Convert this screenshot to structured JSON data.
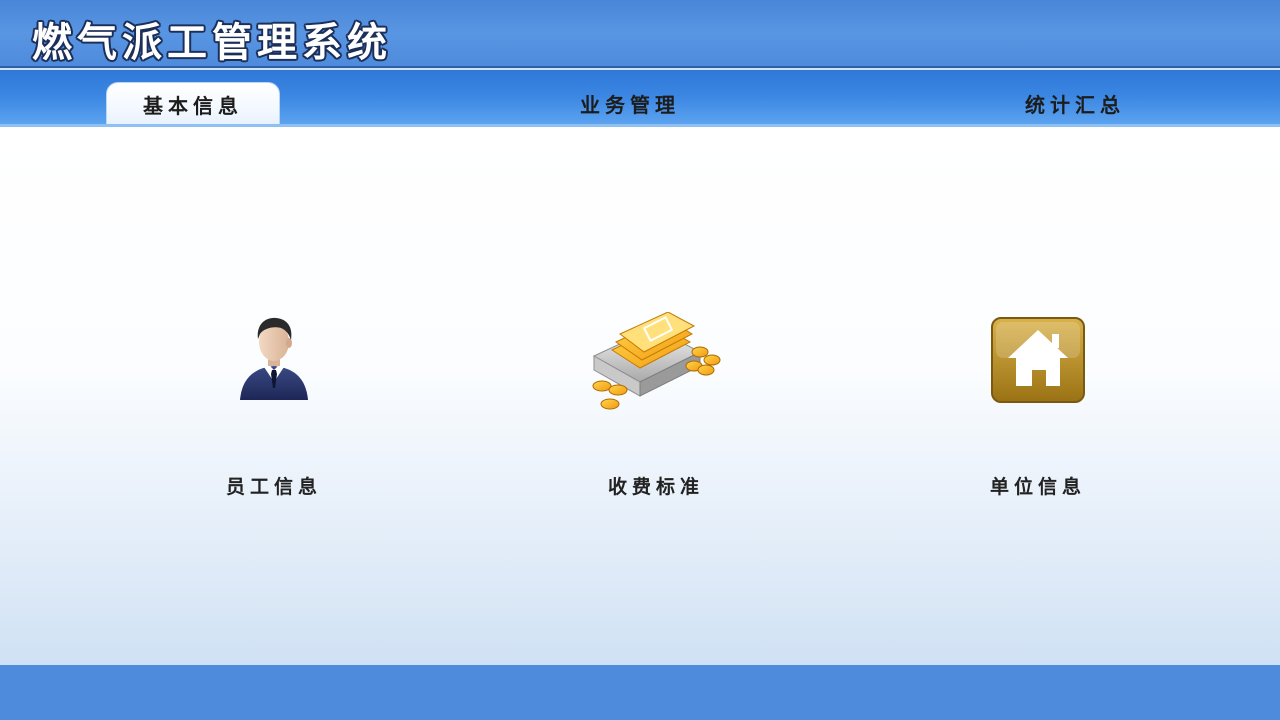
{
  "app": {
    "title": "燃气派工管理系统"
  },
  "tabs": [
    {
      "label": "基本信息",
      "active": true
    },
    {
      "label": "业务管理",
      "active": false
    },
    {
      "label": "统计汇总",
      "active": false
    }
  ],
  "modules": [
    {
      "label": "员工信息",
      "icon": "employee-icon"
    },
    {
      "label": "收费标准",
      "icon": "money-stack-icon"
    },
    {
      "label": "单位信息",
      "icon": "home-icon"
    }
  ],
  "colors": {
    "header_blue": "#4f8bdc",
    "tab_blue": "#3a86e2",
    "home_icon_gold": "#b8892a"
  }
}
